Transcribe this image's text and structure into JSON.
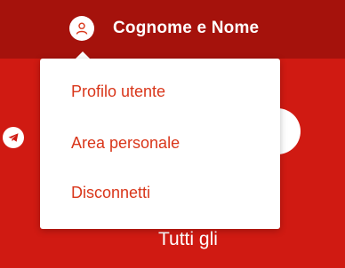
{
  "header": {
    "user_name": "Cognome e Nome",
    "avatar_icon": "user-icon"
  },
  "user_menu": {
    "items": [
      {
        "label": "Profilo utente"
      },
      {
        "label": "Area personale"
      },
      {
        "label": "Disconnetti"
      }
    ]
  },
  "background": {
    "social_icon": "telegram-icon",
    "partial_text": "Tutti gli"
  },
  "colors": {
    "topbar": "#a5120c",
    "page": "#d01a12",
    "menu_text": "#d9361a",
    "menu_bg": "#ffffff"
  }
}
